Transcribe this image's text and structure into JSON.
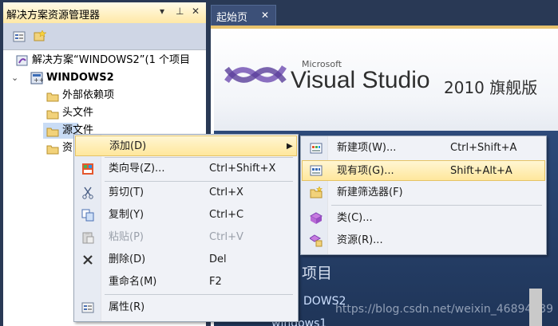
{
  "solution_explorer": {
    "title": "解决方案资源管理器",
    "pin_glyph": "▾ ꟼ ✕",
    "tree": [
      {
        "label": "解决方案“WINDOWS2”(1 个项目",
        "icon": "solution-icon"
      },
      {
        "label": "WINDOWS2",
        "icon": "project-icon"
      },
      {
        "label": "外部依赖项",
        "icon": "folder-icon"
      },
      {
        "label": "头文件",
        "icon": "folder-icon"
      },
      {
        "label": "源文件",
        "icon": "folder-icon"
      },
      {
        "label": "资",
        "icon": "folder-icon"
      }
    ]
  },
  "editor": {
    "tab_label": "起始页",
    "tab_close": "✕",
    "vs_brand": "Microsoft",
    "vs_name": "Visual Studio",
    "vs_edition": "2010 旗舰版",
    "recent_title": "项目",
    "recent_items": [
      "DOWS2",
      "windows1"
    ],
    "watermark": "https://blog.csdn.net/weixin_46894139"
  },
  "context_menu": {
    "items": [
      {
        "label": "添加(D)",
        "shortcut": "",
        "submenu": true,
        "highlighted": true
      },
      {
        "label": "类向导(Z)...",
        "shortcut": "Ctrl+Shift+X",
        "icon": "class-wizard-icon"
      },
      {
        "label": "剪切(T)",
        "shortcut": "Ctrl+X",
        "icon": "cut-icon"
      },
      {
        "label": "复制(Y)",
        "shortcut": "Ctrl+C",
        "icon": "copy-icon"
      },
      {
        "label": "粘贴(P)",
        "shortcut": "Ctrl+V",
        "icon": "paste-icon",
        "disabled": true
      },
      {
        "label": "删除(D)",
        "shortcut": "Del",
        "icon": "delete-icon"
      },
      {
        "label": "重命名(M)",
        "shortcut": "F2"
      },
      {
        "label": "属性(R)",
        "shortcut": "",
        "icon": "properties-icon"
      }
    ]
  },
  "submenu": {
    "items": [
      {
        "label": "新建项(W)...",
        "shortcut": "Ctrl+Shift+A",
        "icon": "new-item-icon"
      },
      {
        "label": "现有项(G)...",
        "shortcut": "Shift+Alt+A",
        "icon": "existing-item-icon",
        "highlighted": true
      },
      {
        "label": "新建筛选器(F)",
        "shortcut": "",
        "icon": "new-filter-icon"
      },
      {
        "label": "类(C)...",
        "shortcut": "",
        "icon": "class-icon"
      },
      {
        "label": "资源(R)...",
        "shortcut": "",
        "icon": "resource-icon"
      }
    ]
  },
  "colors": {
    "ide_background": "#293955",
    "highlight": "#ffe79c",
    "vs_purple": "#68217a"
  }
}
